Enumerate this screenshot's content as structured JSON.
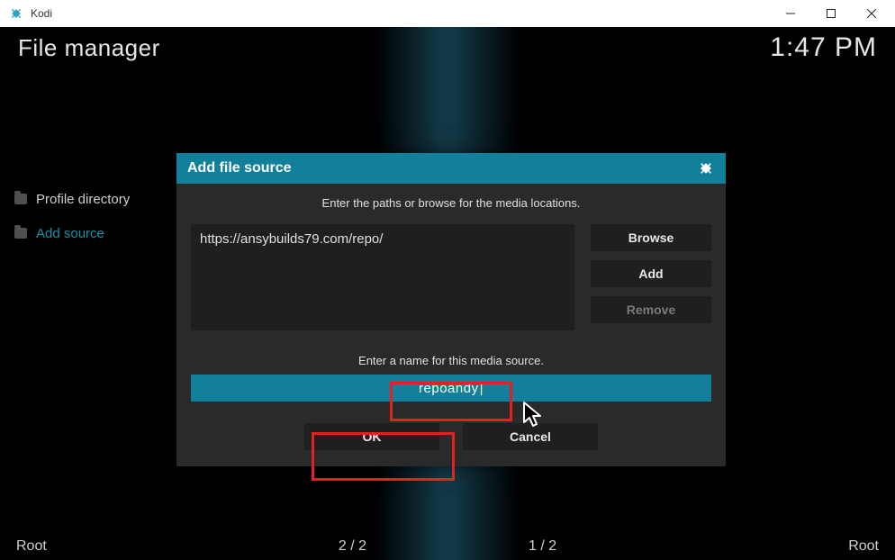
{
  "window": {
    "appName": "Kodi"
  },
  "header": {
    "title": "File manager",
    "time": "1:47 PM"
  },
  "leftList": {
    "items": [
      {
        "label": "Profile directory",
        "active": false
      },
      {
        "label": "Add source",
        "active": true
      }
    ]
  },
  "bottom": {
    "left": "Root",
    "mid1": "2 / 2",
    "mid2": "1 / 2",
    "right": "Root"
  },
  "dialog": {
    "title": "Add file source",
    "hintPaths": "Enter the paths or browse for the media locations.",
    "pathValue": "https://ansybuilds79.com/repo/",
    "buttons": {
      "browse": "Browse",
      "add": "Add",
      "remove": "Remove"
    },
    "hintName": "Enter a name for this media source.",
    "nameValue": "repoandy",
    "actions": {
      "ok": "OK",
      "cancel": "Cancel"
    }
  }
}
